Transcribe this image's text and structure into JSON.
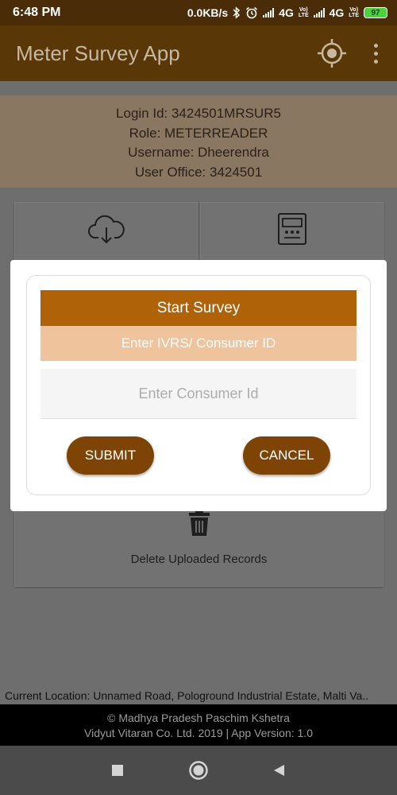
{
  "status_bar": {
    "time": "6:48 PM",
    "net_speed": "0.0KB/s",
    "net1": "4G",
    "net2": "4G",
    "volte1": "Vo)\nLTE",
    "volte2": "Vo)\nLTE",
    "battery": "97",
    "icons": [
      "bluetooth-icon",
      "alarm-icon",
      "signal-icon",
      "signal-icon",
      "battery-icon"
    ]
  },
  "app_bar": {
    "title": "Meter Survey App",
    "icons": [
      "location-target-icon",
      "overflow-menu-icon"
    ]
  },
  "user_info": {
    "login_id": "Login Id: 3424501MRSUR5",
    "role": "Role: METERREADER",
    "username": "Username: Dheerendra",
    "user_office": "User Office: 3424501"
  },
  "cards": {
    "download_icon": "cloud-download-icon",
    "meter_icon": "electric-meter-icon",
    "delete_icon": "trash-icon",
    "delete_label": "Delete Uploaded Records"
  },
  "current_location": "Current Location: Unnamed Road, Pologround Industrial Estate, Malti Va..",
  "footer": {
    "line1": "© Madhya Pradesh Paschim Kshetra",
    "line2": "Vidyut Vitaran Co. Ltd. 2019 | App Version: 1.0"
  },
  "dialog": {
    "title": "Start Survey",
    "subtitle": "Enter IVRS/ Consumer ID",
    "input_placeholder": "Enter Consumer Id",
    "input_value": "",
    "submit_label": "SUBMIT",
    "cancel_label": "CANCEL"
  },
  "nav_bar": {
    "icons": [
      "recents-square-icon",
      "home-circle-icon",
      "back-triangle-icon"
    ]
  },
  "colors": {
    "app_bar": "#5a3707",
    "dialog_header": "#b06208",
    "dialog_subheader": "#efc39c",
    "button": "#7e4406",
    "cursor": "#1d8f7e"
  }
}
